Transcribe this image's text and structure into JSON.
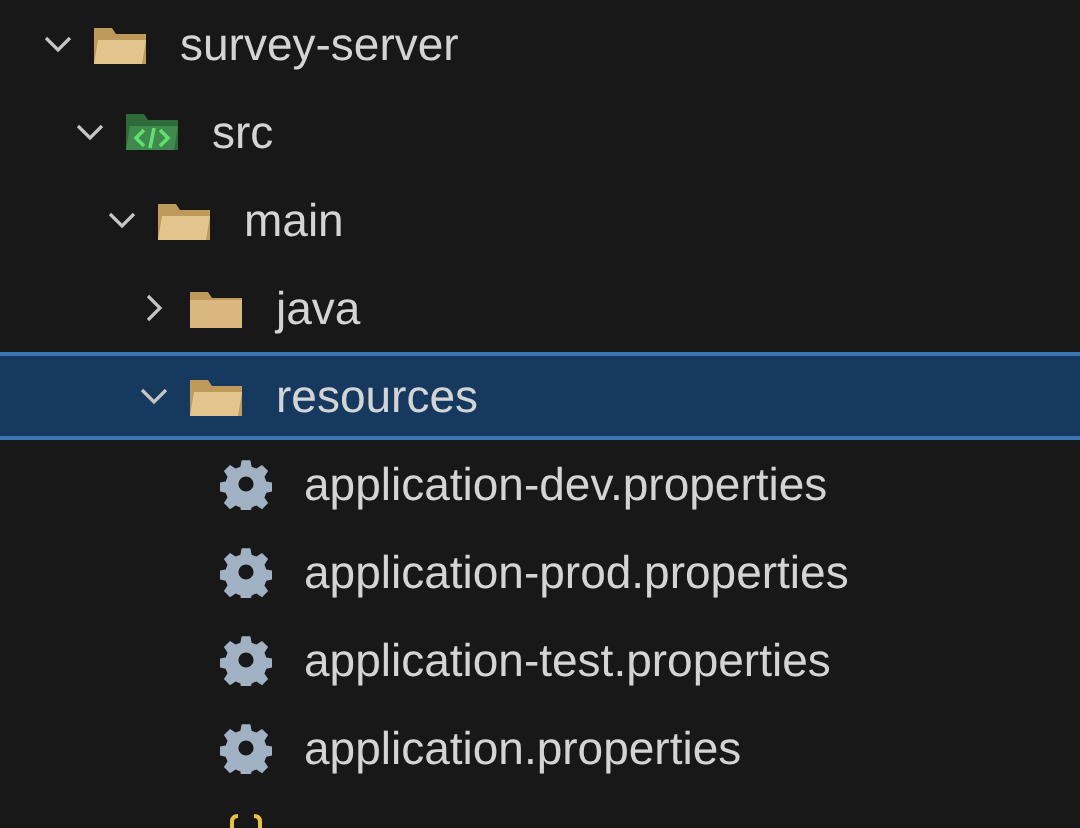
{
  "tree": [
    {
      "label": "survey-server",
      "kind": "folder",
      "expanded": true,
      "selected": false,
      "children": [
        {
          "label": "src",
          "kind": "source-folder",
          "expanded": true,
          "selected": false,
          "children": [
            {
              "label": "main",
              "kind": "folder",
              "expanded": true,
              "selected": false,
              "children": [
                {
                  "label": "java",
                  "kind": "folder",
                  "expanded": false,
                  "selected": false
                },
                {
                  "label": "resources",
                  "kind": "folder",
                  "expanded": true,
                  "selected": true,
                  "children": [
                    {
                      "label": "application-dev.properties",
                      "kind": "settings-file",
                      "selected": false
                    },
                    {
                      "label": "application-prod.properties",
                      "kind": "settings-file",
                      "selected": false
                    },
                    {
                      "label": "application-test.properties",
                      "kind": "settings-file",
                      "selected": false
                    },
                    {
                      "label": "application.properties",
                      "kind": "settings-file",
                      "selected": false
                    },
                    {
                      "kind": "json-file",
                      "selected": false
                    }
                  ]
                }
              ]
            }
          ]
        }
      ]
    }
  ]
}
